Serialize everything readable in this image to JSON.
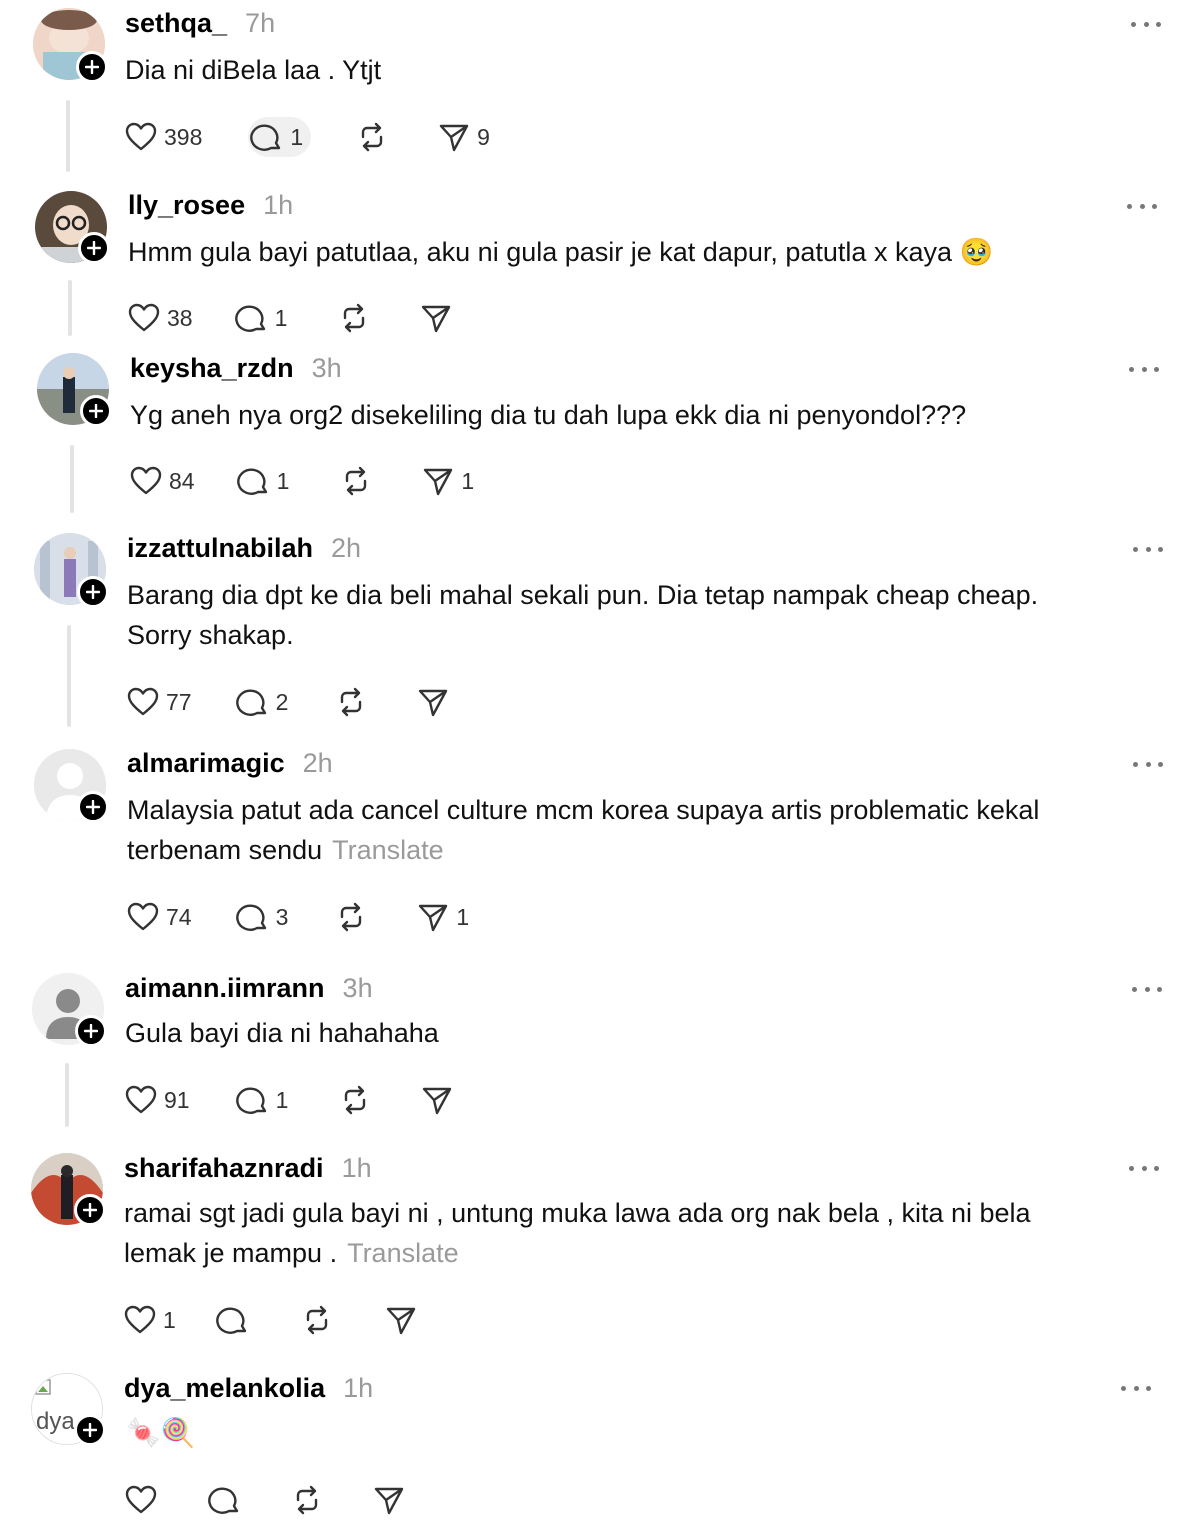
{
  "posts": [
    {
      "username": "sethqa_",
      "time": "7h",
      "text": "Dia ni diBela laa . Ytjt",
      "likes": "398",
      "replies": "1",
      "reposts": "",
      "shares": "9"
    },
    {
      "username": "lly_rosee",
      "time": "1h",
      "text": "Hmm gula bayi patutlaa, aku ni gula pasir je kat dapur, patutla x kaya 🥹",
      "likes": "38",
      "replies": "1",
      "reposts": "",
      "shares": ""
    },
    {
      "username": "keysha_rzdn",
      "time": "3h",
      "text": "Yg aneh nya org2 disekeliling dia tu dah lupa ekk dia ni penyondol???",
      "likes": "84",
      "replies": "1",
      "reposts": "",
      "shares": "1"
    },
    {
      "username": "izzattulnabilah",
      "time": "2h",
      "text": "Barang dia dpt ke dia beli mahal sekali pun. Dia tetap nampak cheap cheap.",
      "text2": "Sorry shakap.",
      "likes": "77",
      "replies": "2",
      "reposts": "",
      "shares": ""
    },
    {
      "username": "almarimagic",
      "time": "2h",
      "text": "Malaysia patut ada cancel culture mcm korea supaya artis problematic kekal",
      "text2": "terbenam sendu",
      "translate": "Translate",
      "likes": "74",
      "replies": "3",
      "reposts": "",
      "shares": "1"
    },
    {
      "username": "aimann.iimrann",
      "time": "3h",
      "text": "Gula bayi dia ni hahahaha",
      "likes": "91",
      "replies": "1",
      "reposts": "",
      "shares": ""
    },
    {
      "username": "sharifahaznradi",
      "time": "1h",
      "text": "ramai sgt jadi gula bayi ni , untung muka lawa ada org nak bela , kita ni bela",
      "text2": "lemak je mampu .",
      "translate": "Translate",
      "likes": "1",
      "replies": "",
      "reposts": "",
      "shares": ""
    },
    {
      "username": "dya_melankolia",
      "time": "1h",
      "text": "🍬🍭",
      "avatar_alt": "dya",
      "likes": "",
      "replies": "",
      "reposts": "",
      "shares": ""
    }
  ],
  "icons": {
    "like": "heart-icon",
    "reply": "comment-icon",
    "repost": "repost-icon",
    "share": "send-icon",
    "more": "more-icon",
    "follow": "plus-icon"
  },
  "colors": {
    "text": "#111111",
    "muted": "#9a9a9a",
    "thread": "#e3e3e3",
    "badge": "#000000"
  }
}
